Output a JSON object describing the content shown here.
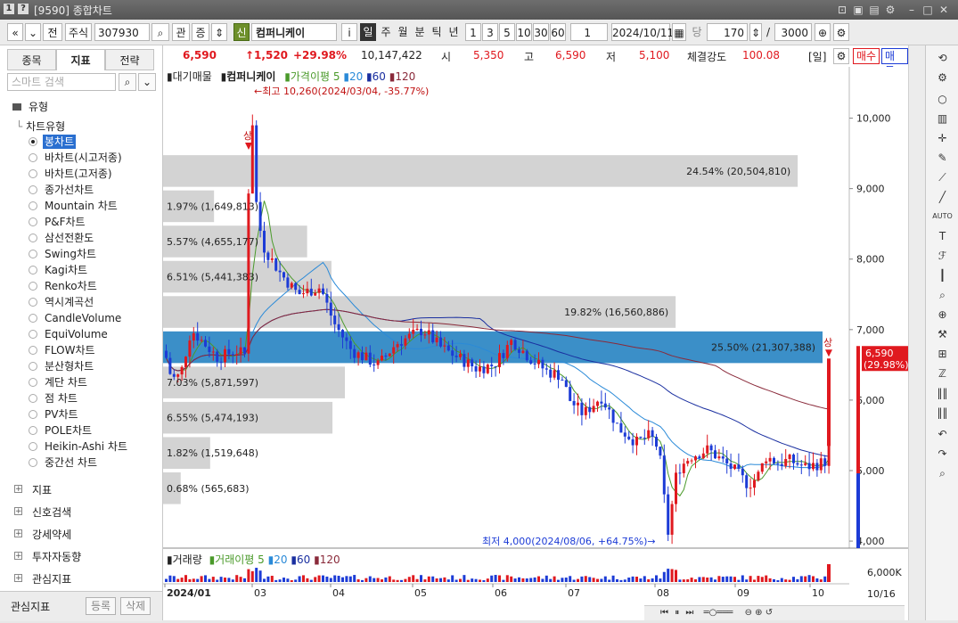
{
  "window": {
    "title": "[9590] 종합차트"
  },
  "toolbar": {
    "type_label": "주식",
    "code": "307930",
    "jeon": "전",
    "gwan": "관",
    "jeung": "증",
    "new_badge": "신",
    "stock_name": "컴퍼니케이",
    "info": "i",
    "periods": [
      "일",
      "주",
      "월",
      "분",
      "틱",
      "년"
    ],
    "numbers": [
      "1",
      "3",
      "5",
      "10",
      "30",
      "60"
    ],
    "unit_value": "1",
    "date": "2024/10/11",
    "dang": "당",
    "count": "170",
    "total": "3000"
  },
  "left_panel": {
    "tabs": [
      "종목",
      "지표",
      "전략"
    ],
    "search_placeholder": "스마트 검색",
    "group_label": "유형",
    "subgroup_label": "차트유형",
    "chart_types": [
      "봉차트",
      "바차트(시고저종)",
      "바차트(고저종)",
      "종가선차트",
      "Mountain 차트",
      "P&F차트",
      "삼선전환도",
      "Swing차트",
      "Kagi차트",
      "Renko차트",
      "역시계곡선",
      "CandleVolume",
      "EquiVolume",
      "FLOW차트",
      "분산형차트",
      "계단 차트",
      "점 차트",
      "PV차트",
      "POLE차트",
      "Heikin-Ashi 차트",
      "중간선 차트"
    ],
    "sections": [
      "지표",
      "신호검색",
      "강세약세",
      "투자자동향",
      "관심지표"
    ],
    "footer_label": "관심지표",
    "register": "등록",
    "delete": "삭제"
  },
  "price_bar": {
    "price": "6,590",
    "change": "↑1,520",
    "change_pct": "+29.98%",
    "volume": "10,147,422",
    "open_label": "시",
    "open": "5,350",
    "high_label": "고",
    "high": "6,590",
    "low_label": "저",
    "low": "5,100",
    "strength_label": "체결강도",
    "strength": "100.08",
    "period_tag": "[일]",
    "buy": "매수",
    "sell": "매도"
  },
  "chart_legend": {
    "indicator": "대기매물",
    "stock": "컴퍼니케이",
    "ma_label": "가격이평",
    "ma5": "5",
    "ma20": "20",
    "ma60": "60",
    "ma120": "120"
  },
  "volume_legend": {
    "label": "거래량",
    "ma_label": "거래이평",
    "ma5": "5",
    "ma20": "20",
    "ma60": "60",
    "ma120": "120",
    "axis_label": "6,000K",
    "date_tag": "10/16"
  },
  "annotations": {
    "high": "←최고 10,260(2024/03/04, -35.77%)",
    "low": "최저 4,000(2024/08/06, +64.75%)→",
    "sang": "상",
    "last_price": "6,590",
    "last_pct": "(29.98%)"
  },
  "colors": {
    "up": "#e0191f",
    "down": "#1c3bd6",
    "ma5": "#4a9a2a",
    "ma20": "#2a8ad8",
    "ma60": "#1a2fa0",
    "ma120": "#8a2a3a",
    "highlight": "#3b8fc8"
  },
  "chart_data": {
    "type": "candlestick",
    "y_axis_ticks": [
      "10,000",
      "9,000",
      "8,000",
      "7,000",
      "6,000",
      "5,000",
      "4,000"
    ],
    "y_range": [
      3900,
      10500
    ],
    "x_labels": [
      "2024/01",
      "03",
      "04",
      "05",
      "06",
      "07",
      "08",
      "09",
      "10"
    ],
    "high": {
      "value": 10260,
      "date": "2024/03/04"
    },
    "low": {
      "value": 4000,
      "date": "2024/08/06"
    },
    "last": {
      "value": 6590,
      "change_pct": 29.98
    },
    "volume_profile": [
      {
        "price": 9250,
        "label": "24.54% (20,504,810)",
        "pct": 24.54
      },
      {
        "price": 8750,
        "label": "1.97% (1,649,813)",
        "pct": 1.97
      },
      {
        "price": 8250,
        "label": "5.57% (4,655,177)",
        "pct": 5.57
      },
      {
        "price": 7750,
        "label": "6.51% (5,441,383)",
        "pct": 6.51
      },
      {
        "price": 7250,
        "label": "19.82% (16,560,886)",
        "pct": 19.82
      },
      {
        "price": 6750,
        "label": "25.50% (21,307,388)",
        "pct": 25.5,
        "highlight": true
      },
      {
        "price": 6250,
        "label": "7.03% (5,871,597)",
        "pct": 7.03
      },
      {
        "price": 5750,
        "label": "6.55% (5,474,193)",
        "pct": 6.55
      },
      {
        "price": 5250,
        "label": "1.82% (1,519,648)",
        "pct": 1.82
      },
      {
        "price": 4750,
        "label": "0.68% (565,683)",
        "pct": 0.68
      }
    ]
  }
}
